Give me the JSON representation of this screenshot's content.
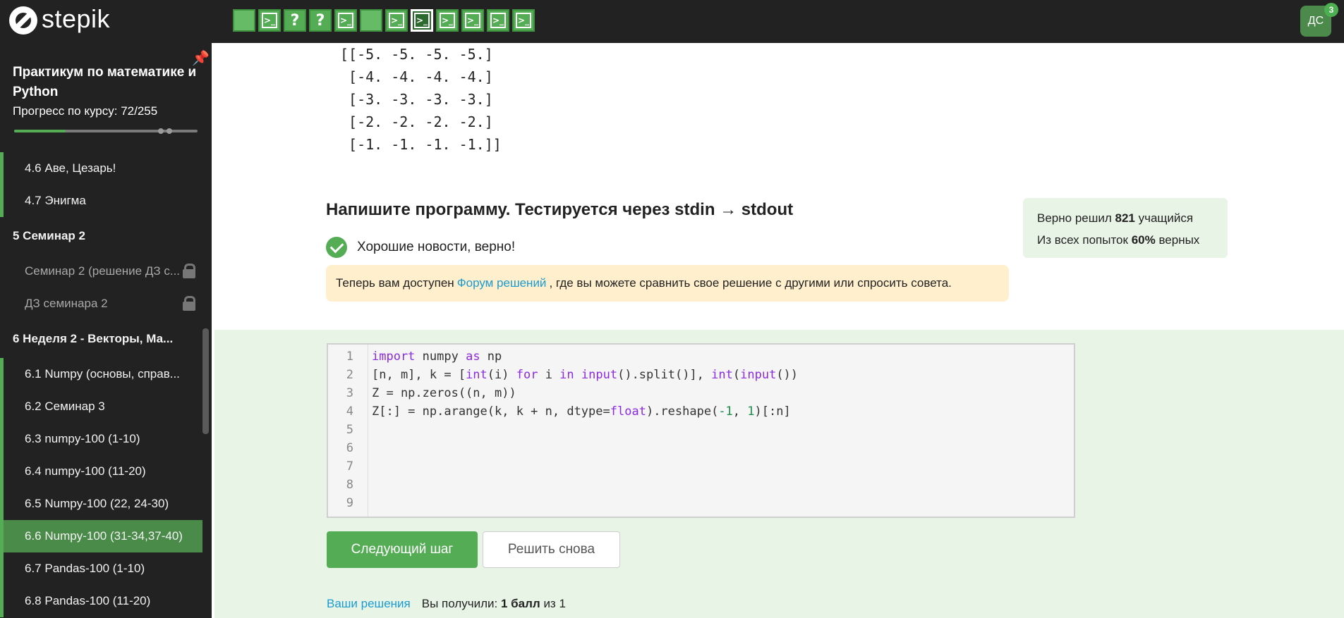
{
  "header": {
    "logo_text": "stepik",
    "steps": [
      {
        "kind": "plain",
        "glyph": ""
      },
      {
        "kind": "code",
        "glyph": ">_"
      },
      {
        "kind": "quiz",
        "glyph": "?"
      },
      {
        "kind": "quiz",
        "glyph": "?"
      },
      {
        "kind": "code",
        "glyph": ">_"
      },
      {
        "kind": "plain",
        "glyph": ""
      },
      {
        "kind": "code",
        "glyph": ">_"
      },
      {
        "kind": "code-current",
        "glyph": ">_"
      },
      {
        "kind": "code",
        "glyph": ">_"
      },
      {
        "kind": "code",
        "glyph": ">_"
      },
      {
        "kind": "code",
        "glyph": ">_"
      },
      {
        "kind": "code",
        "glyph": ">_"
      }
    ],
    "avatar_initials": "ДС",
    "notifications": "3"
  },
  "sidebar": {
    "course_title": "Практикум по математике и Python",
    "progress_label": "Прогресс по курсу:",
    "progress_value": "72/255",
    "progress_fraction": 0.28,
    "items": [
      {
        "label": "4.6  Аве, Цезарь!",
        "state": "done"
      },
      {
        "label": "4.7  Энигма",
        "state": "done"
      },
      {
        "label": "5  Семинар 2",
        "state": "section"
      },
      {
        "label": "Семинар 2 (решение ДЗ с...",
        "state": "locked"
      },
      {
        "label": "ДЗ семинара 2",
        "state": "locked"
      },
      {
        "label": "6  Неделя 2 - Векторы, Ма...",
        "state": "section"
      },
      {
        "label": "6.1  Numpy (основы, справ...",
        "state": "done"
      },
      {
        "label": "6.2  Семинар 3",
        "state": "done"
      },
      {
        "label": "6.3  numpy-100 (1-10)",
        "state": "done"
      },
      {
        "label": "6.4  numpy-100 (11-20)",
        "state": "done"
      },
      {
        "label": "6.5  Numpy-100 (22, 24-30)",
        "state": "done"
      },
      {
        "label": "6.6  Numpy-100 (31-34,37-40)",
        "state": "active"
      },
      {
        "label": "6.7  Pandas-100 (1-10)",
        "state": "done"
      },
      {
        "label": "6.8  Pandas-100 (11-20)",
        "state": "done"
      }
    ]
  },
  "main": {
    "sample_output": "[[-5. -5. -5. -5.]\n [-4. -4. -4. -4.]\n [-3. -3. -3. -3.]\n [-2. -2. -2. -2.]\n [-1. -1. -1. -1.]]",
    "task_heading": "Напишите программу. Тестируется через stdin → stdout",
    "verdict": "Хорошие новости, верно!",
    "forum_note_before": "Теперь вам доступен",
    "forum_link": "Форум решений",
    "forum_note_after": ", где вы можете сравнить свое решение с другими или спросить совета.",
    "stats": {
      "solved_prefix": "Верно решил",
      "solved_count": "821",
      "solved_suffix": "учащийся",
      "attempts_prefix": "Из всех попыток",
      "attempts_percent": "60%",
      "attempts_suffix": "верных"
    },
    "editor": {
      "line_numbers": [
        "1",
        "2",
        "3",
        "4",
        "5",
        "6",
        "7",
        "8",
        "9"
      ],
      "lines": [
        "import numpy as np",
        "[n, m], k = [int(i) for i in input().split()], int(input())",
        "Z = np.zeros((n, m))",
        "Z[:] = np.arange(k, k + n, dtype=float).reshape(-1, 1)[:n]",
        "",
        "",
        "",
        "",
        ""
      ]
    },
    "next_button": "Следующий шаг",
    "retry_button": "Решить снова",
    "your_solutions_link": "Ваши решения",
    "score_prefix": "Вы получили:",
    "score_value": "1 балл",
    "score_suffix": "из 1"
  },
  "colors": {
    "accent": "#54ad54",
    "dark": "#222222",
    "link": "#1b9bd1",
    "note_bg": "#ffefcc",
    "success_bg": "#e8f5e6"
  }
}
